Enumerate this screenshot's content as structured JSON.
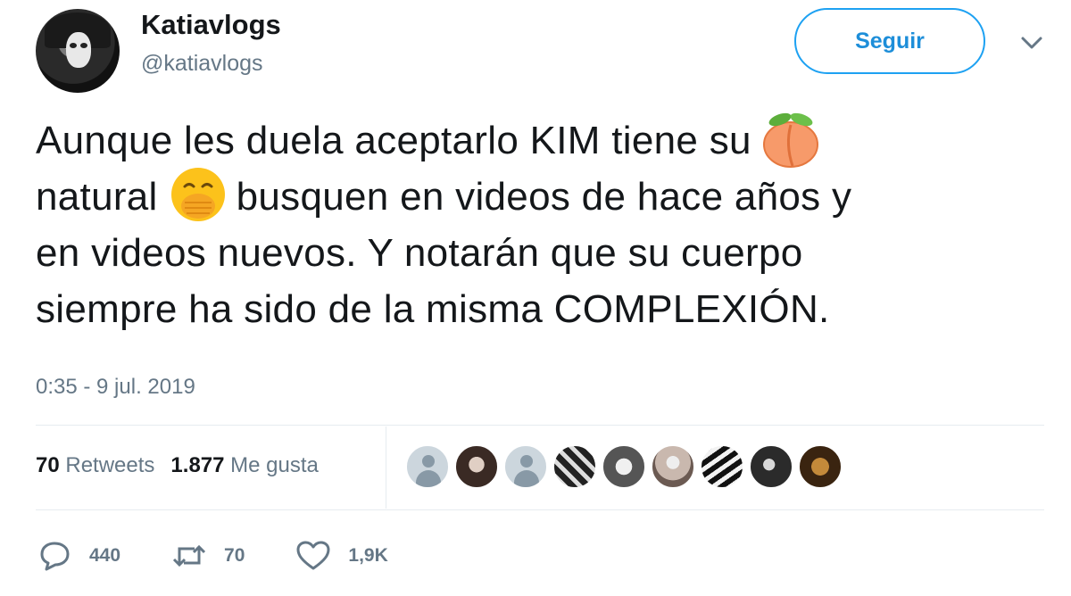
{
  "author": {
    "display_name": "Katiavlogs",
    "handle": "@katiavlogs",
    "avatar_icon": "user-avatar-photo"
  },
  "follow_button": {
    "label": "Seguir",
    "color": "#1da1f2"
  },
  "menu_icon": "chevron-down-icon",
  "tweet": {
    "lines": [
      "Aunque les duela aceptarlo KIM tiene su",
      "natural",
      "busquen en videos de hace años y",
      "en videos nuevos. Y notarán que su cuerpo",
      "siempre ha sido de la misma COMPLEXIÓN."
    ],
    "emojis": [
      "peach-emoji",
      "face-with-hand-over-mouth-emoji"
    ]
  },
  "timestamp": "0:35 - 9 jul. 2019",
  "stats": {
    "retweets_count": "70",
    "retweets_label": "Retweets",
    "likes_count": "1.877",
    "likes_label": "Me gusta"
  },
  "likers": [
    "default-avatar",
    "user-photo",
    "default-avatar",
    "user-photo",
    "user-photo",
    "user-photo",
    "user-photo",
    "user-photo",
    "user-photo"
  ],
  "actions": {
    "reply_count": "440",
    "retweet_count": "70",
    "like_count": "1,9K"
  },
  "colors": {
    "text": "#14171a",
    "secondary": "#657786",
    "accent": "#1da1f2",
    "divider": "#e6ecf0"
  }
}
